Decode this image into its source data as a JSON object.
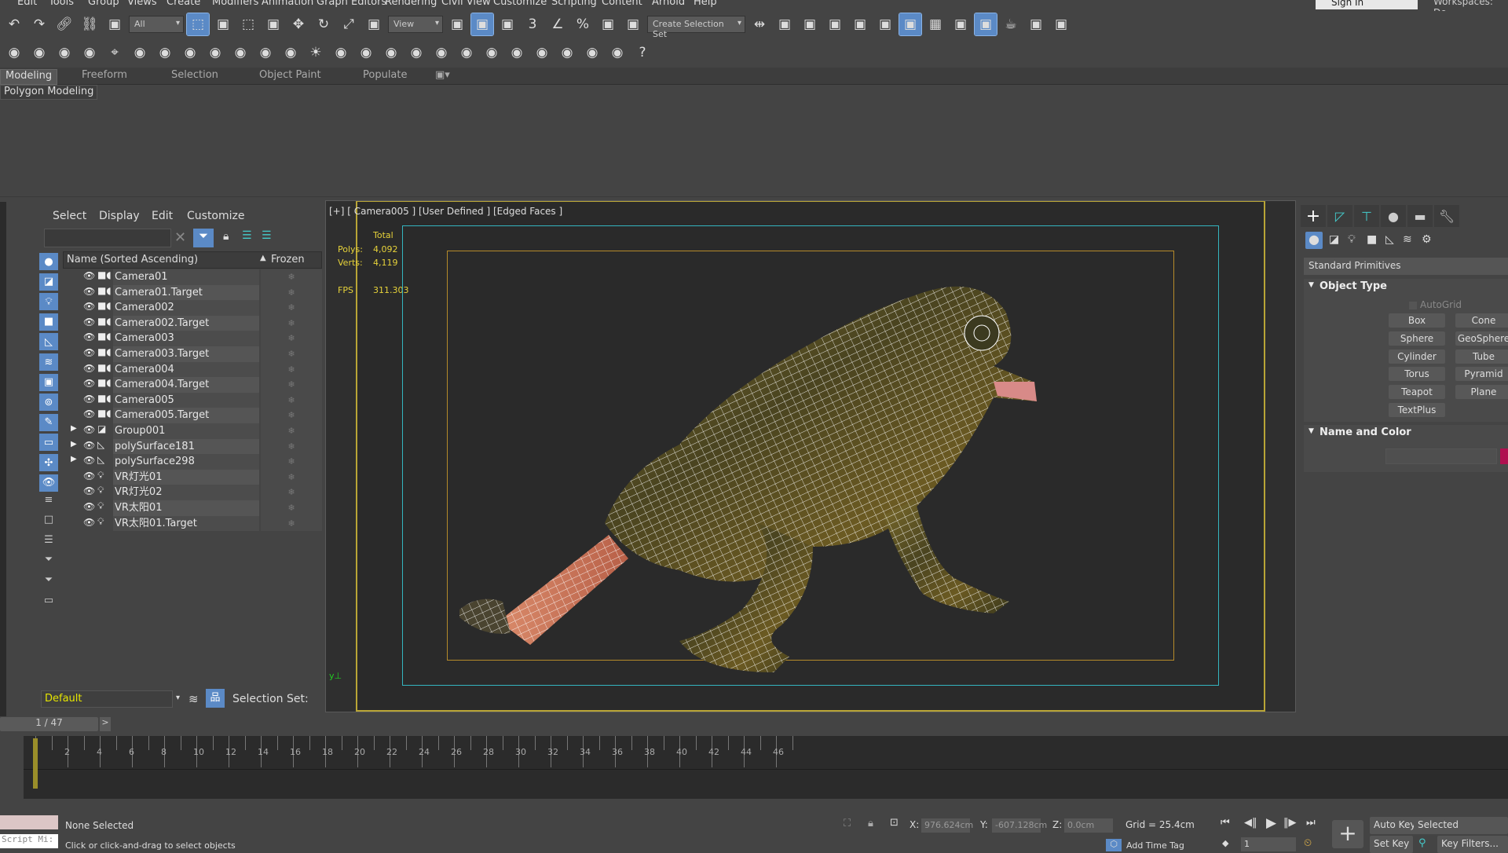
{
  "menu": [
    "Edit",
    "Tools",
    "Group",
    "Views",
    "Create",
    "Modifiers",
    "Animation",
    "Graph Editors",
    "Rendering",
    "Civil View",
    "Customize",
    "Scripting",
    "Content",
    "Arnold",
    "Help"
  ],
  "signin": "Sign In",
  "workspaces": "Workspaces: De",
  "toolbar1": {
    "selection_filter": "All",
    "ref_coord": "View",
    "named_selection": "Create Selection Set",
    "icons": [
      "undo-icon",
      "redo-icon",
      "link-icon",
      "unlink-icon",
      "bind-spacewarp-icon",
      "|filter",
      "select-object-icon",
      "select-by-name-icon",
      "rect-selection-icon",
      "window-crossing-icon",
      "move-icon",
      "rotate-icon",
      "scale-icon",
      "placement-icon",
      "|view",
      "pivot-icon",
      "select-manipulate-icon",
      "keyboard-shortcut-icon",
      "snap-3d-icon",
      "angle-snap-icon",
      "percent-snap-icon",
      "spinner-snap-icon",
      "edit-named-sel-icon",
      "|named",
      "mirror-icon",
      "align-icon",
      "scene-explorer-icon",
      "layer-explorer-icon",
      "toggle-ribbon-icon",
      "curve-editor-icon",
      "schematic-view-icon",
      "material-editor-icon",
      "render-setup-icon",
      "rendered-frame-icon",
      "render-icon",
      "render-cloud-icon",
      "a360-icon"
    ]
  },
  "toolbar2_icons": [
    "render-setup2-icon",
    "scene-states-icon",
    "batch-render-icon",
    "light-lister-icon",
    "camera-icon",
    "sunlight-icon",
    "daylight-icon",
    "plane-light-icon",
    "sphere-light-icon",
    "disc-light-icon",
    "ies-light-icon",
    "cone-light-icon",
    "sun-icon",
    "dome-light-icon",
    "proxy-icon",
    "fur-icon",
    "mesh-clipper-icon",
    "volume-icon",
    "grass-icon",
    "hair-icon",
    "infinite-plane-icon",
    "material-icon",
    "texture-icon",
    "vfb-icon",
    "frame-buffer-icon",
    "help-icon"
  ],
  "ribbon": {
    "tabs": [
      "Modeling",
      "Freeform",
      "Selection",
      "Object Paint",
      "Populate"
    ],
    "sub": "Polygon Modeling"
  },
  "explorer": {
    "menus": [
      "Select",
      "Display",
      "Edit",
      "Customize"
    ],
    "col_name": "Name (Sorted Ascending)",
    "col_frozen": "Frozen",
    "rows": [
      {
        "name": "Camera01",
        "type": "camera"
      },
      {
        "name": "Camera01.Target",
        "type": "camera"
      },
      {
        "name": "Camera002",
        "type": "camera"
      },
      {
        "name": "Camera002.Target",
        "type": "camera"
      },
      {
        "name": "Camera003",
        "type": "camera"
      },
      {
        "name": "Camera003.Target",
        "type": "camera"
      },
      {
        "name": "Camera004",
        "type": "camera"
      },
      {
        "name": "Camera004.Target",
        "type": "camera"
      },
      {
        "name": "Camera005",
        "type": "camera"
      },
      {
        "name": "Camera005.Target",
        "type": "camera"
      },
      {
        "name": "Group001",
        "type": "group",
        "expand": true
      },
      {
        "name": "polySurface181",
        "type": "geometry",
        "expand": true
      },
      {
        "name": "polySurface298",
        "type": "geometry",
        "expand": true
      },
      {
        "name": "VR灯光01",
        "type": "light"
      },
      {
        "name": "VR灯光02",
        "type": "light"
      },
      {
        "name": "VR太阳01",
        "type": "light"
      },
      {
        "name": "VR太阳01.Target",
        "type": "light"
      }
    ],
    "layer": "Default",
    "selection_set": "Selection Set:"
  },
  "viewport": {
    "label": "[+] [ Camera005 ] [User Defined ] [Edged Faces ]",
    "stats_header": "Total",
    "polys_label": "Polys:",
    "polys": "4,092",
    "verts_label": "Verts:",
    "verts": "4,119",
    "fps_label": "FPS",
    "fps": "311.303"
  },
  "command_panel": {
    "category": "Standard Primitives",
    "object_type": "Object Type",
    "autogrid": "AutoGrid",
    "buttons": [
      "Box",
      "Cone",
      "Sphere",
      "GeoSphere",
      "Cylinder",
      "Tube",
      "Torus",
      "Pyramid",
      "Teapot",
      "Plane",
      "TextPlus"
    ],
    "name_color": "Name and Color",
    "object_color": "#b01050"
  },
  "timeline": {
    "frame": "1 / 47",
    "labels": [
      "2",
      "4",
      "6",
      "8",
      "10",
      "12",
      "14",
      "16",
      "18",
      "20",
      "22",
      "24",
      "26",
      "28",
      "30",
      "32",
      "34",
      "36",
      "38",
      "40",
      "42",
      "44",
      "46"
    ],
    "current_frame": 1
  },
  "status": {
    "script": "Script Mi:",
    "selected": "None Selected",
    "prompt": "Click or click-and-drag to select objects",
    "x_label": "X:",
    "x": "976.624cm",
    "y_label": "Y:",
    "y": "-607.128cm",
    "z_label": "Z:",
    "z": "0.0cm",
    "grid": "Grid = 25.4cm",
    "add_time_tag": "Add Time Tag",
    "frame_field": "1",
    "auto_key": "Auto Key",
    "key_mode": "Selected",
    "set_key": "Set Key",
    "key_filters": "Key Filters..."
  },
  "colors": {
    "accent": "#5b8ac6",
    "safe_frame": "#b9a536",
    "cyan_frame": "#34b5c0",
    "stats": "#e6d23a"
  }
}
